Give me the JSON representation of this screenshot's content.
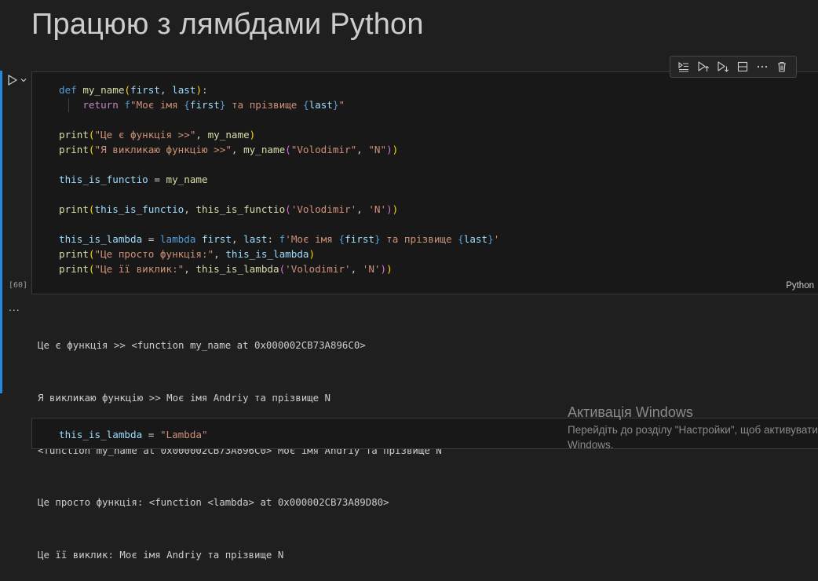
{
  "markdown": {
    "title": "Працюю з лямбдами Python"
  },
  "cell": {
    "execution_count": "[60]",
    "language": "Python"
  },
  "toolbar": {
    "items": [
      "run-by-line",
      "execute-above",
      "execute-below",
      "split-cell",
      "more",
      "delete"
    ]
  },
  "code_lines": [
    "def my_name(first, last):",
    "    return f\"Моє імя {first} та прізвище {last}\"",
    "",
    "print(\"Це є функція >>\", my_name)",
    "print(\"Я викликаю функцію >>\", my_name(\"Volodimir\", \"N\"))",
    "",
    "this_is_functio = my_name",
    "",
    "print(this_is_functio, this_is_functio('Volodimir', 'N'))",
    "",
    "this_is_lambda = lambda first, last: f'Моє імя {first} та прізвище {last}'",
    "print(\"Це просто функція:\", this_is_lambda)",
    "print(\"Це її виклик:\", this_is_lambda('Volodimir', 'N'))"
  ],
  "output": {
    "dots": "...",
    "lines": [
      "Це є функція >> <function my_name at 0x000002CB73A896C0>",
      "Я викликаю функцію >> Моє імя Andriy та прізвище N",
      "<function my_name at 0x000002CB73A896C0> Моє імя Andriy та прізвище N",
      "Це просто функція: <function <lambda> at 0x000002CB73A89D80>",
      "Це її виклик: Моє імя Andriy та прізвище N"
    ]
  },
  "cell2": {
    "code": "this_is_lambda = \"Lambda\""
  },
  "watermark": {
    "title": "Активація Windows",
    "subtitle": "Перейдіть до розділу \"Настройки\", щоб активувати Windows."
  },
  "colors": {
    "accent": "#2489db",
    "background": "#1f1f1f",
    "editor": "#181818",
    "keyword": "#569cd6",
    "function": "#dcdcaa",
    "variable": "#9cdcfe",
    "string": "#ce9178"
  }
}
